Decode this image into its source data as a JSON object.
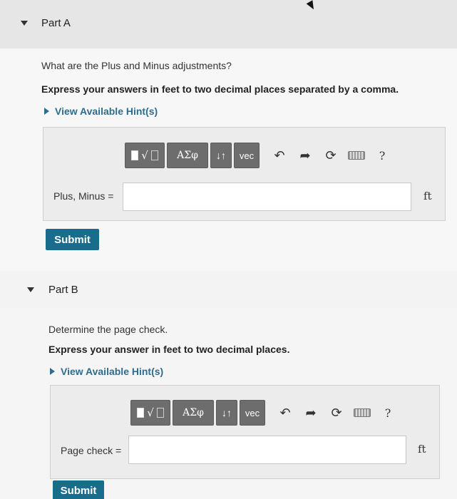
{
  "part_a": {
    "title": "Part A",
    "question": "What are the Plus and Minus adjustments?",
    "instruction": "Express your answers in feet to two decimal places separated by a comma.",
    "hint_label": "View Available Hint(s)",
    "toolbar": {
      "greek_label": "ΑΣφ",
      "sort_label": "↓↑",
      "vec_label": "vec",
      "help_label": "?"
    },
    "field_label": "Plus, Minus =",
    "input_value": "",
    "unit": "ft",
    "submit_label": "Submit"
  },
  "part_b": {
    "title": "Part B",
    "question": "Determine the page check.",
    "instruction": "Express your answer in feet to two decimal places.",
    "hint_label": "View Available Hint(s)",
    "toolbar": {
      "greek_label": "ΑΣφ",
      "sort_label": "↓↑",
      "vec_label": "vec",
      "help_label": "?"
    },
    "field_label": "Page check =",
    "input_value": "",
    "unit": "ft",
    "submit_label": "Submit"
  },
  "icons": {
    "root_glyph": "√",
    "undo_glyph": "↶",
    "redo_glyph": "➦",
    "reset_glyph": "⟳"
  }
}
